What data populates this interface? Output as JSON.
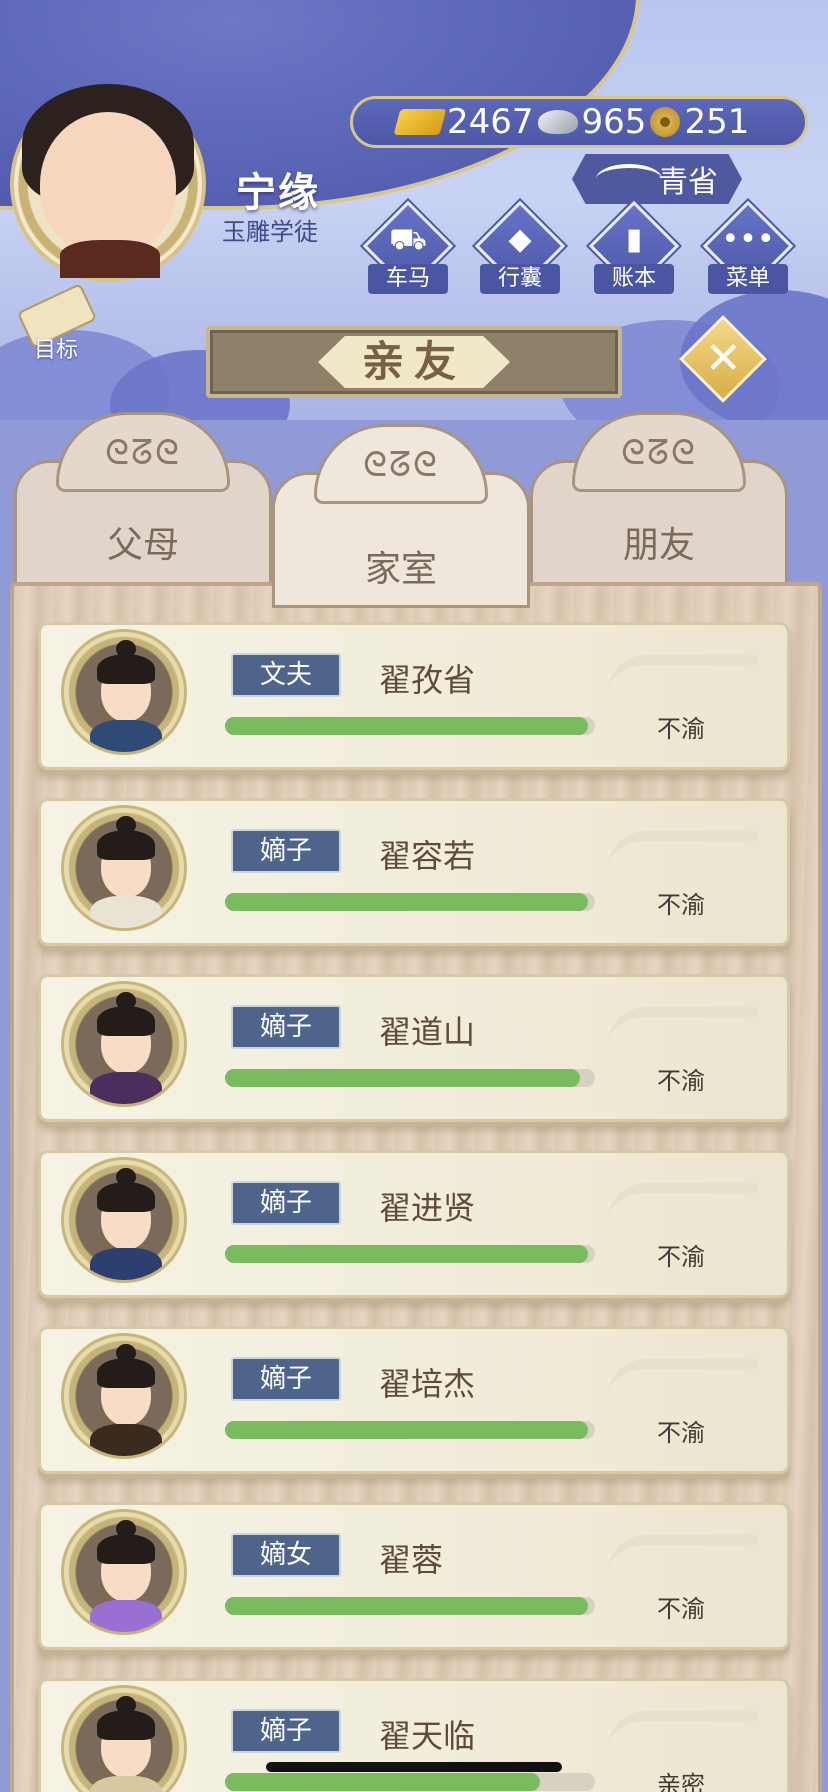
{
  "player": {
    "name": "宁缘",
    "title": "玉雕学徒"
  },
  "currency": {
    "gold": "2467",
    "silver": "965",
    "coin": "251"
  },
  "region": "青省",
  "menu": [
    {
      "label": "车马",
      "icon": "carriage-icon"
    },
    {
      "label": "行囊",
      "icon": "bag-icon"
    },
    {
      "label": "账本",
      "icon": "ledger-icon"
    },
    {
      "label": "菜单",
      "icon": "more-icon"
    }
  ],
  "goal_label": "目标",
  "page_title": "亲友",
  "tabs": [
    {
      "label": "父母",
      "active": false
    },
    {
      "label": "家室",
      "active": true
    },
    {
      "label": "朋友",
      "active": false
    }
  ],
  "members": [
    {
      "role": "文夫",
      "name": "翟孜省",
      "mood": "不渝",
      "affinity": 0.98,
      "robe": "#2f4a74"
    },
    {
      "role": "嫡子",
      "name": "翟容若",
      "mood": "不渝",
      "affinity": 0.98,
      "robe": "#e9e3d3"
    },
    {
      "role": "嫡子",
      "name": "翟道山",
      "mood": "不渝",
      "affinity": 0.96,
      "robe": "#4b2d5e"
    },
    {
      "role": "嫡子",
      "name": "翟进贤",
      "mood": "不渝",
      "affinity": 0.98,
      "robe": "#2c3f6f"
    },
    {
      "role": "嫡子",
      "name": "翟培杰",
      "mood": "不渝",
      "affinity": 0.98,
      "robe": "#3a2b1e"
    },
    {
      "role": "嫡女",
      "name": "翟蓉",
      "mood": "不渝",
      "affinity": 0.98,
      "robe": "#9a6fd4"
    },
    {
      "role": "嫡子",
      "name": "翟天临",
      "mood": "亲密",
      "affinity": 0.85,
      "robe": "#d8c9a2"
    }
  ]
}
